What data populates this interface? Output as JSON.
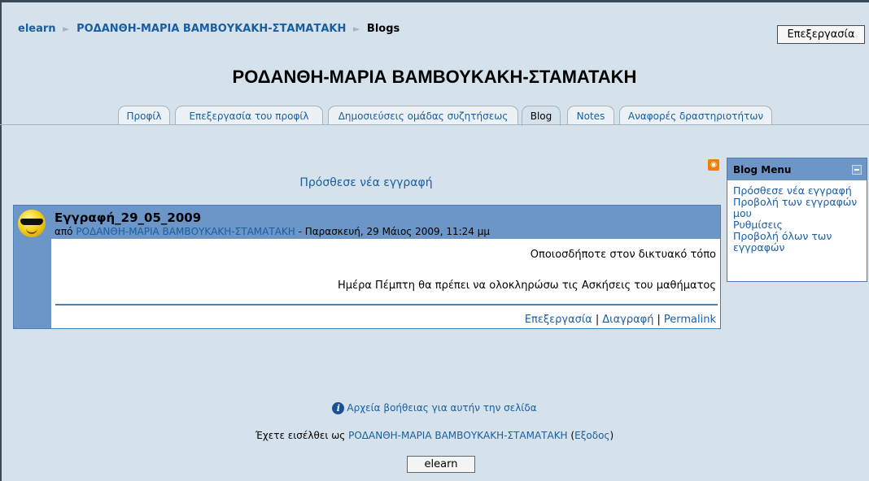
{
  "breadcrumb": {
    "home": "elearn",
    "user": "ΡΟΔΑΝΘΗ-ΜΑΡΙΑ ΒΑΜΒΟΥΚΑΚΗ-ΣΤΑΜΑΤΑΚΗ",
    "current": "Blogs",
    "separator": "►"
  },
  "header": {
    "edit_button": "Επεξεργασία",
    "title": "ΡΟΔΑΝΘΗ-ΜΑΡΙΑ ΒΑΜΒΟΥΚΑΚΗ-ΣΤΑΜΑΤΑΚΗ"
  },
  "tabs": [
    {
      "label": "Προφίλ",
      "active": false
    },
    {
      "label": "Επεξεργασία του προφίλ",
      "active": false
    },
    {
      "label": "Δημοσιεύσεις ομάδας συζητήσεως",
      "active": false
    },
    {
      "label": "Blog",
      "active": true
    },
    {
      "label": "Notes",
      "active": false
    },
    {
      "label": "Αναφορές δραστηριοτήτων",
      "active": false
    }
  ],
  "main": {
    "add_entry": "Πρόσθεσε νέα εγγραφή",
    "rss_icon": "rss-icon"
  },
  "post": {
    "title": "Εγγραφή_29_05_2009",
    "by_prefix": "από",
    "author": "ΡΟΔΑΝΘΗ-ΜΑΡΙΑ ΒΑΜΒΟΥΚΑΚΗ-ΣΤΑΜΑΤΑΚΗ",
    "date": " - Παρασκευή, 29 Μάιος 2009, 11:24 μμ",
    "publish_state": "Οποιοσδήποτε στον δικτυακό τόπο",
    "body": "Ημέρα Πέμπτη θα πρέπει να ολοκληρώσω τις Ασκήσεις του μαθήματος",
    "actions": {
      "edit": "Επεξεργασία",
      "delete": "Διαγραφή",
      "permalink": "Permalink",
      "separator": "|"
    }
  },
  "blog_menu": {
    "title": "Blog Menu",
    "items": [
      "Πρόσθεσε νέα εγγραφή",
      "Προβολή των εγγραφών μου",
      "Ρυθμίσεις",
      "Προβολή όλων των εγγραφών"
    ]
  },
  "footer": {
    "help_link": "Αρχεία βοήθειας για αυτήν την σελίδα",
    "logged_in_prefix": "Έχετε εισέλθει ως",
    "logged_in_user": "ΡΟΔΑΝΘΗ-ΜΑΡΙΑ ΒΑΜΒΟΥΚΑΚΗ-ΣΤΑΜΑΤΑΚΗ",
    "logout_open": "(",
    "logout": "Εξοδος",
    "logout_close": ")",
    "home_button": "elearn"
  },
  "colors": {
    "page_bg": "#d5e1eb",
    "accent": "#6b96c7",
    "link": "#1a5ea0",
    "rss": "#f07f0a"
  }
}
